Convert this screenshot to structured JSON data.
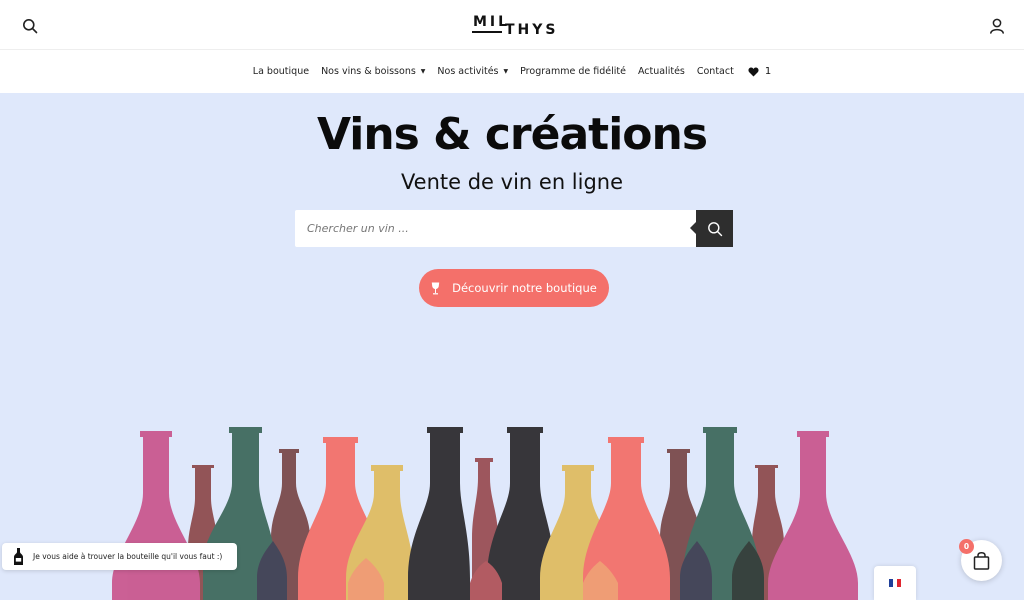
{
  "header": {
    "logo_line1": "MIL",
    "logo_line2": "THYS",
    "search_icon": "search-icon",
    "account_icon": "user-icon"
  },
  "nav": {
    "items": [
      {
        "label": "La boutique"
      },
      {
        "label": "Nos vins & boissons"
      },
      {
        "label": "Nos activités"
      },
      {
        "label": "Programme de fidélité"
      },
      {
        "label": "Actualités"
      },
      {
        "label": "Contact"
      }
    ],
    "wishlist_count": "1",
    "caret": "▼"
  },
  "hero": {
    "title": "Vins & créations",
    "subtitle": "Vente de vin en ligne",
    "search_placeholder": "Chercher un vin ...",
    "cta_label": "Découvrir notre boutique"
  },
  "chat": {
    "message": "Je vous aide à trouver la bouteille qu'il vous faut :)"
  },
  "cart": {
    "count": "0"
  },
  "colors": {
    "hero_bg": "#dfe8fb",
    "accent": "#f4706a",
    "dark": "#2e2e2e"
  }
}
